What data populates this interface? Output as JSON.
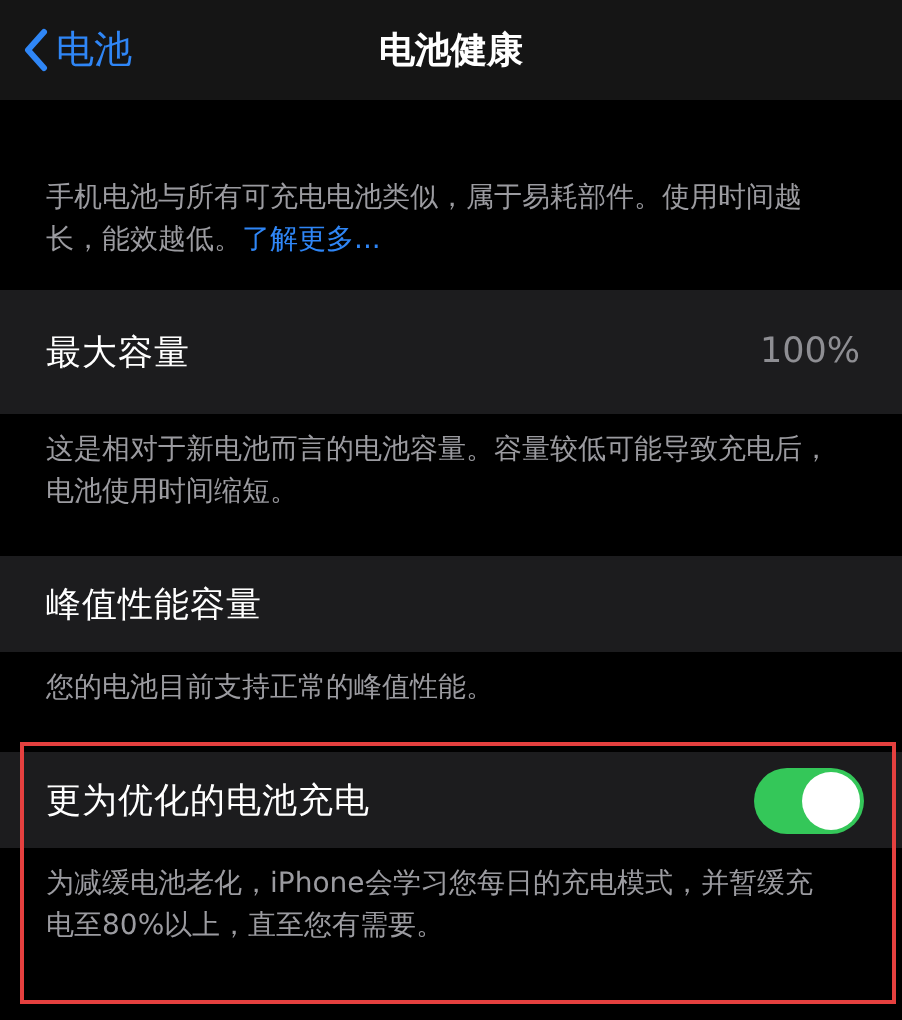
{
  "nav": {
    "back": "电池",
    "title": "电池健康"
  },
  "intro": {
    "text": "手机电池与所有可充电电池类似，属于易耗部件。使用时间越长，能效越低。",
    "link": "了解更多..."
  },
  "rows": [
    {
      "kind": "value",
      "label": "最大容量",
      "value": "100%",
      "footer": "这是相对于新电池而言的电池容量。容量较低可能导致充电后，电池使用时间缩短。",
      "highlighted": false
    },
    {
      "kind": "plain",
      "label": "峰值性能容量",
      "footer": "您的电池目前支持正常的峰值性能。",
      "highlighted": false
    },
    {
      "kind": "toggle",
      "label": "更为优化的电池充电",
      "on": true,
      "footer": "为减缓电池老化，iPhone会学习您每日的充电模式，并暂缓充电至80%以上，直至您有需要。",
      "highlighted": true
    }
  ]
}
